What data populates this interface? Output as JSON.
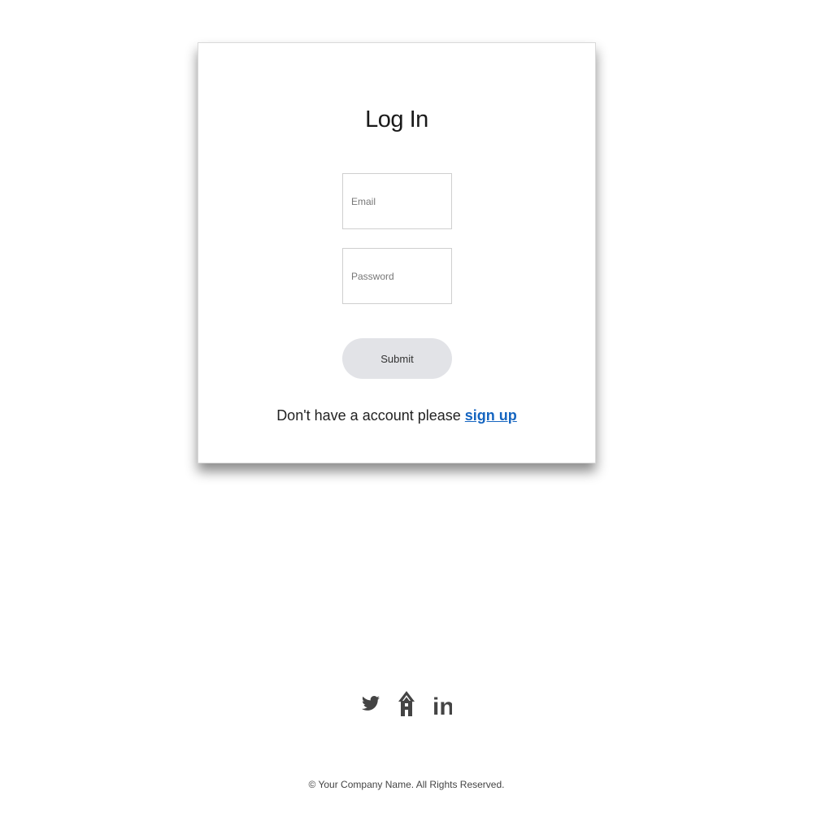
{
  "login": {
    "title": "Log In",
    "email_placeholder": "Email",
    "password_placeholder": "Password",
    "submit_label": "Submit",
    "signup_prompt": "Don't have a account please",
    "signup_link": "sign up"
  },
  "social": {
    "icons": [
      "twitter-icon",
      "home-icon",
      "linkedin-icon"
    ],
    "linkedin_text": "in"
  },
  "footer": {
    "copyright": "© Your Company Name. All Rights Reserved."
  },
  "colors": {
    "link": "#1565c0",
    "button_bg": "#e2e3e7",
    "icon": "#444444"
  }
}
